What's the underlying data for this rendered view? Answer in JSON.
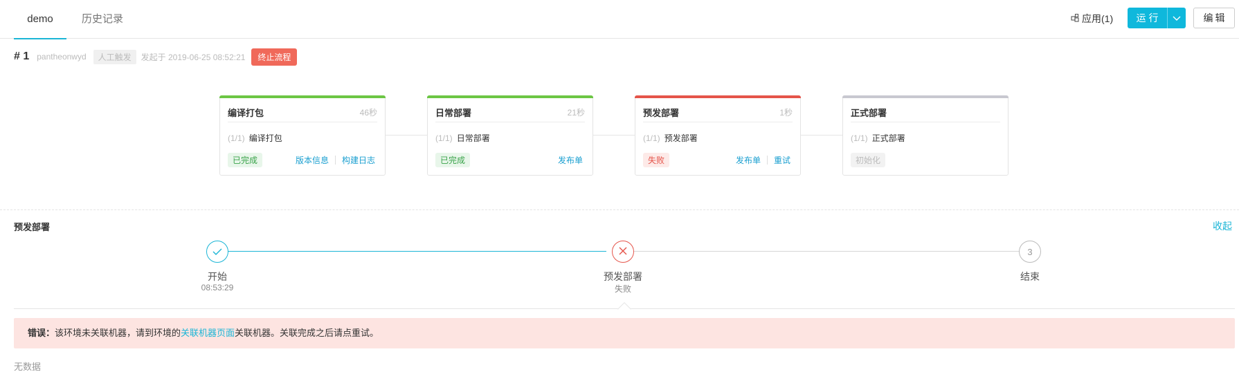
{
  "tabs": [
    {
      "label": "demo"
    },
    {
      "label": "历史记录"
    }
  ],
  "toolbar": {
    "apps_label": "应用(1)",
    "run_label": "运行",
    "edit_label": "编辑"
  },
  "build": {
    "number": "# 1",
    "user": "pantheonwyd",
    "trigger": "人工触发",
    "started": "发起于 2019-06-25 08:52:21",
    "stop_label": "终止流程"
  },
  "stages": [
    {
      "title": "编译打包",
      "duration": "46秒",
      "count": "(1/1)",
      "job": "编译打包",
      "status": "已完成",
      "status_type": "done",
      "links": [
        "版本信息",
        "构建日志"
      ],
      "color": "#6cc644"
    },
    {
      "title": "日常部署",
      "duration": "21秒",
      "count": "(1/1)",
      "job": "日常部署",
      "status": "已完成",
      "status_type": "done",
      "links": [
        "发布单"
      ],
      "color": "#6cc644"
    },
    {
      "title": "预发部署",
      "duration": "1秒",
      "count": "(1/1)",
      "job": "预发部署",
      "status": "失败",
      "status_type": "fail",
      "links": [
        "发布单",
        "重试"
      ],
      "color": "#e5544a"
    },
    {
      "title": "正式部署",
      "duration": "",
      "count": "(1/1)",
      "job": "正式部署",
      "status": "初始化",
      "status_type": "init",
      "links": [],
      "color": "#c8c8d0"
    }
  ],
  "detail": {
    "title": "预发部署",
    "collapse_label": "收起",
    "steps": [
      {
        "label": "开始",
        "sub": "08:53:29",
        "state": "done"
      },
      {
        "label": "预发部署",
        "sub": "失败",
        "state": "fail"
      },
      {
        "label": "结束",
        "sub": "",
        "state": "pending",
        "number": "3"
      }
    ],
    "error": {
      "prefix": "错误：",
      "text_before": "该环境未关联机器，请到环境的",
      "link": "关联机器页面",
      "text_after": "关联机器。关联完成之后请点重试。"
    },
    "nodata": "无数据"
  },
  "colors": {
    "accent": "#1ab5d6",
    "success": "#3aa34a",
    "danger": "#e5544a"
  }
}
